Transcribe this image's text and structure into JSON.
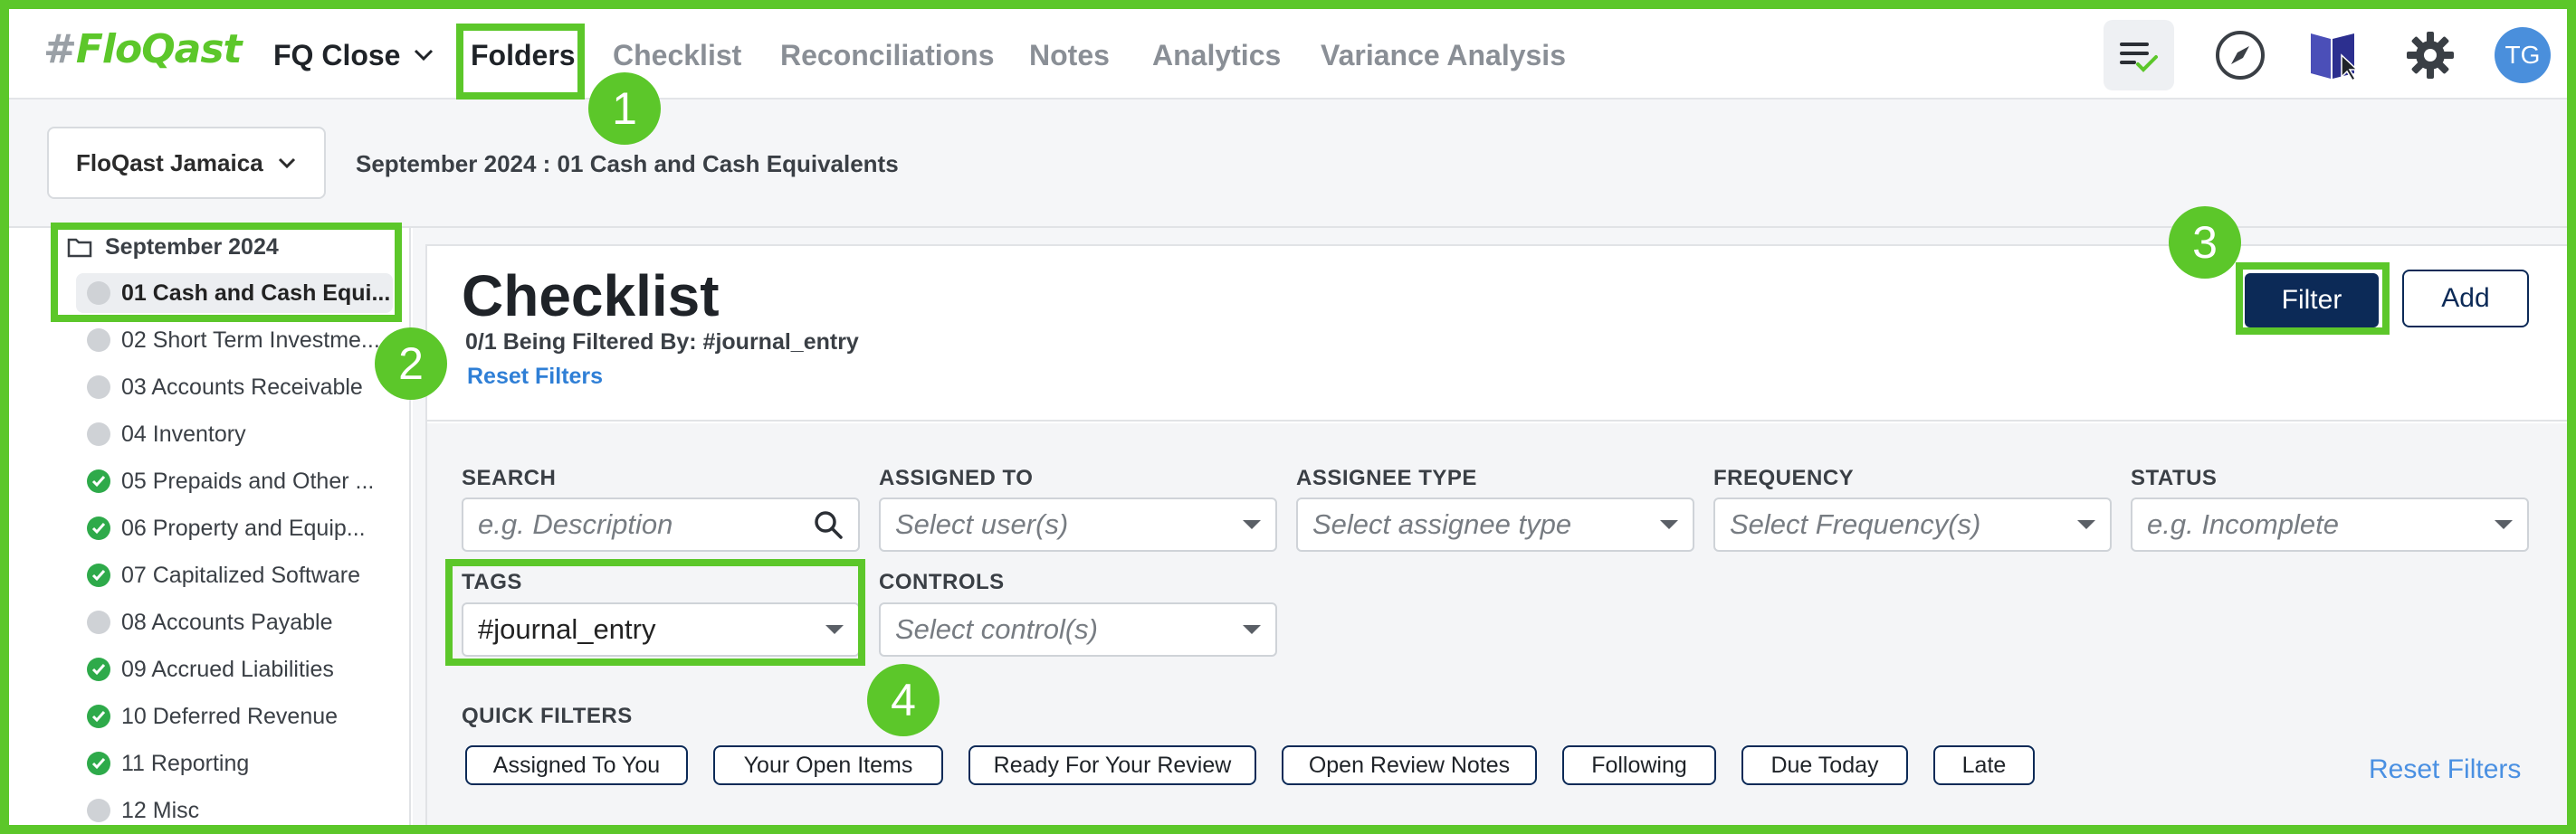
{
  "nav": {
    "logo_hash": "#",
    "logo_text": "FloQast",
    "close_label": "FQ Close",
    "links": [
      "Folders",
      "Checklist",
      "Reconciliations",
      "Notes",
      "Analytics",
      "Variance Analysis"
    ],
    "active_link": "Folders",
    "avatar_initials": "TG"
  },
  "subheader": {
    "entity": "FloQast Jamaica",
    "breadcrumb": "September 2024 : 01 Cash and Cash Equivalents"
  },
  "sidebar": {
    "folder": "September 2024",
    "items": [
      {
        "label": "01 Cash and Cash Equi...",
        "status": "incomplete",
        "active": true
      },
      {
        "label": "02 Short Term Investme...",
        "status": "incomplete"
      },
      {
        "label": "03 Accounts Receivable",
        "status": "incomplete"
      },
      {
        "label": "04 Inventory",
        "status": "incomplete"
      },
      {
        "label": "05 Prepaids and Other ...",
        "status": "complete"
      },
      {
        "label": "06 Property and Equip...",
        "status": "complete"
      },
      {
        "label": "07 Capitalized Software",
        "status": "complete"
      },
      {
        "label": "08 Accounts Payable",
        "status": "incomplete"
      },
      {
        "label": "09 Accrued Liabilities",
        "status": "complete"
      },
      {
        "label": "10 Deferred Revenue",
        "status": "complete"
      },
      {
        "label": "11 Reporting",
        "status": "complete"
      },
      {
        "label": "12 Misc",
        "status": "incomplete"
      }
    ]
  },
  "main": {
    "title": "Checklist",
    "filter_status": "0/1 Being Filtered By: #journal_entry",
    "reset_filters": "Reset Filters",
    "filter_button": "Filter",
    "add_button": "Add"
  },
  "filters": {
    "search": {
      "label": "SEARCH",
      "placeholder": "e.g. Description"
    },
    "assigned_to": {
      "label": "ASSIGNED TO",
      "placeholder": "Select user(s)"
    },
    "assignee_type": {
      "label": "ASSIGNEE TYPE",
      "placeholder": "Select assignee type"
    },
    "frequency": {
      "label": "FREQUENCY",
      "placeholder": "Select Frequency(s)"
    },
    "status": {
      "label": "STATUS",
      "placeholder": "e.g. Incomplete"
    },
    "tags": {
      "label": "TAGS",
      "value": "#journal_entry"
    },
    "controls": {
      "label": "CONTROLS",
      "placeholder": "Select control(s)"
    }
  },
  "quick_filters": {
    "label": "QUICK FILTERS",
    "chips": [
      "Assigned To You",
      "Your Open Items",
      "Ready For Your Review",
      "Open Review Notes",
      "Following",
      "Due Today",
      "Late"
    ],
    "reset": "Reset Filters"
  },
  "annotations": [
    "1",
    "2",
    "3",
    "4"
  ],
  "colors": {
    "highlight": "#5cc72a",
    "primary_button": "#0c2a57",
    "link": "#2f7fd6",
    "complete": "#2eaa4a"
  }
}
